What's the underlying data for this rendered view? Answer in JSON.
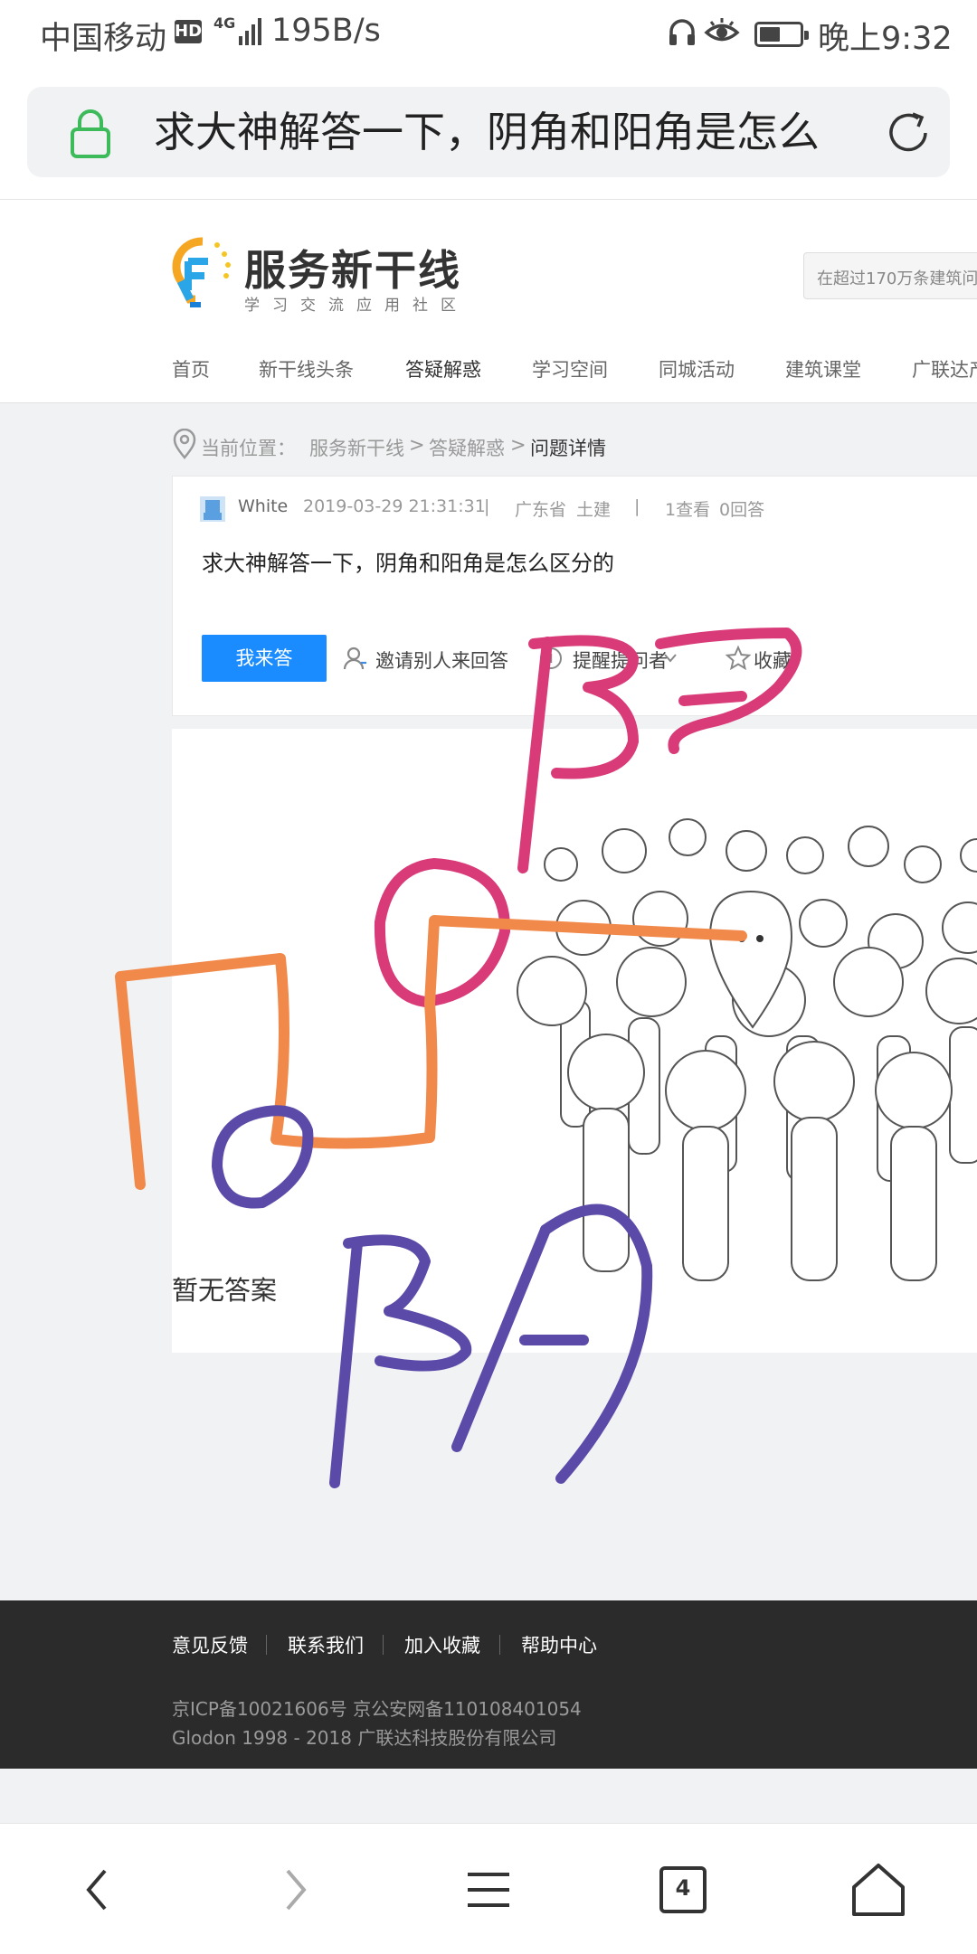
{
  "status_bar": {
    "carrier": "中国移动",
    "hd": "HD",
    "network": "4G",
    "speed": "195B/s",
    "time": "晚上9:32"
  },
  "address_bar": {
    "url_title": "求大神解答一下，阴角和阳角是怎么"
  },
  "site": {
    "logo_title": "服务新干线",
    "logo_subtitle": "学习交流应用社区",
    "search_placeholder": "在超过170万条建筑问",
    "nav": [
      "首页",
      "新干线头条",
      "答疑解惑",
      "学习空间",
      "同城活动",
      "建筑课堂",
      "广联达产"
    ],
    "nav_active": "答疑解惑"
  },
  "breadcrumb": {
    "label": "当前位置：",
    "home": "服务新干线",
    "sep1": ">",
    "section": "答疑解惑",
    "sep2": ">",
    "current": "问题详情"
  },
  "question": {
    "author": "White",
    "datetime": "2019-03-29 21:31:31",
    "divider": "|",
    "region": "广东省",
    "tag": "土建",
    "views": "1查看",
    "answers": "0回答",
    "title": "求大神解答一下，阴角和阳角是怎么区分的",
    "answer_button": "我来答",
    "invite": "邀请别人来回答",
    "remind": "提醒提问者",
    "favorite": "收藏"
  },
  "answers_area": {
    "empty_text": "暂无答案"
  },
  "footer": {
    "links": [
      "意见反馈",
      "联系我们",
      "加入收藏",
      "帮助中心"
    ],
    "icp": "京ICP备10021606号   京公安网备110108401054",
    "copyright": "Glodon 1998 - 2018 广联达科技股份有限公司"
  },
  "bottom_nav": {
    "tab_count": "4"
  },
  "colors": {
    "accent_blue": "#1a8cff",
    "lock_green": "#3dbb5b",
    "doodle_pink": "#d93a78",
    "doodle_orange": "#f0894a",
    "doodle_purple": "#5b4aa8",
    "footer_bg": "#2b2b2b"
  }
}
